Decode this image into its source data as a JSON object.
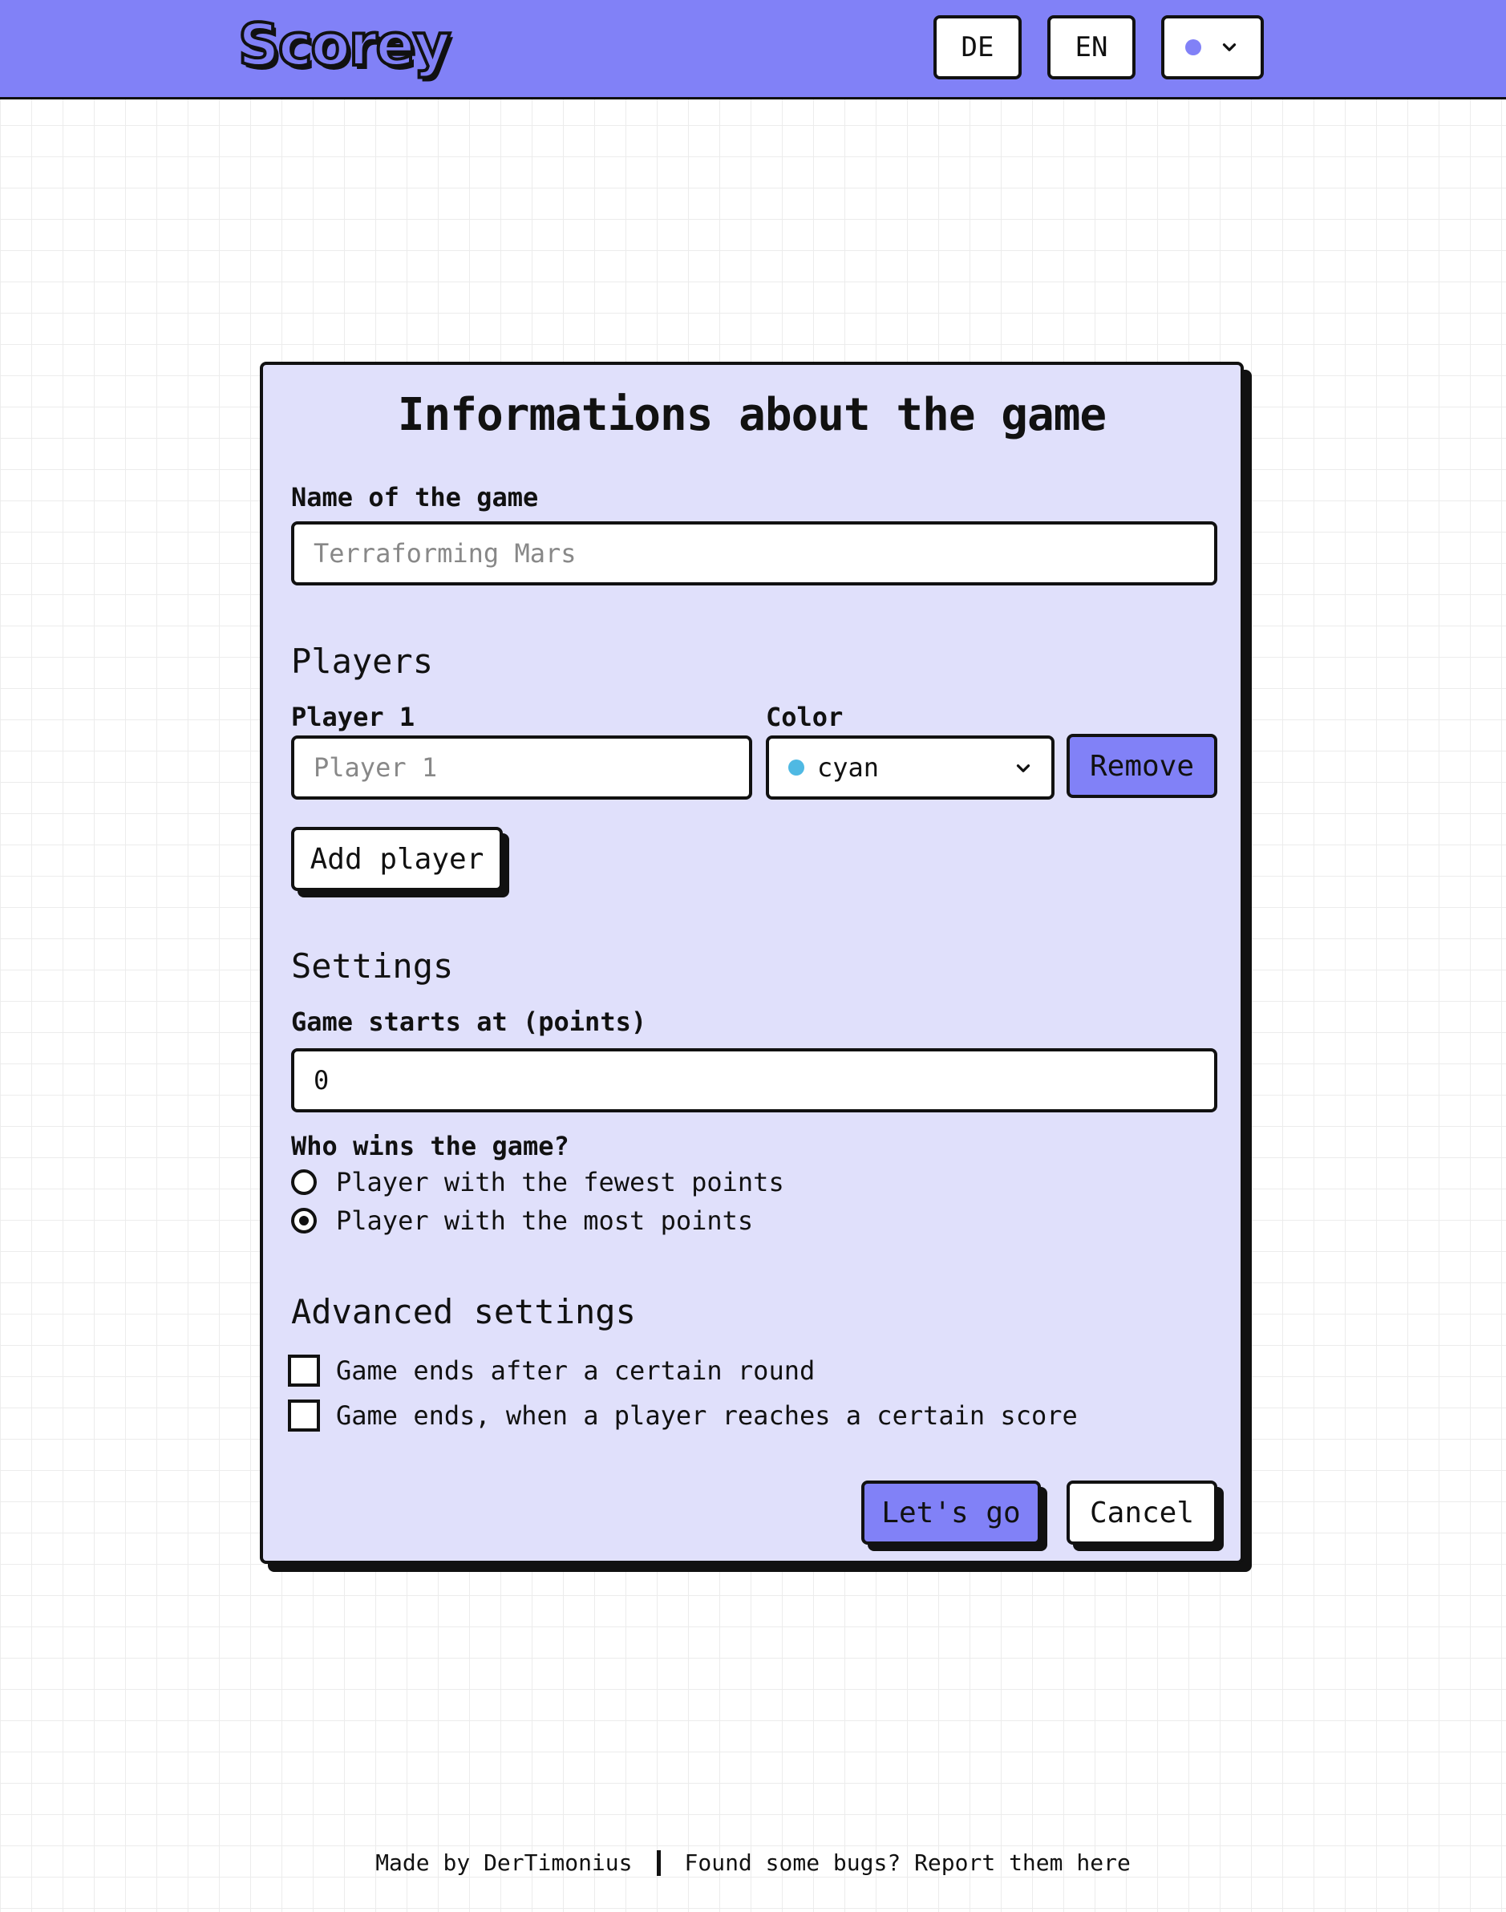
{
  "header": {
    "logo": "Scorey",
    "lang_de": "DE",
    "lang_en": "EN",
    "theme_color": "#8181f7"
  },
  "card": {
    "title": "Informations about the game",
    "game_name": {
      "label": "Name of the game",
      "placeholder": "Terraforming Mars",
      "value": ""
    },
    "players_section": "Players",
    "players": [
      {
        "label": "Player 1",
        "placeholder": "Player 1",
        "color_label": "Color",
        "color_value": "cyan",
        "color_hex": "#4fb9e3",
        "remove_label": "Remove"
      }
    ],
    "add_player_label": "Add player",
    "settings_section": "Settings",
    "start_points": {
      "label": "Game starts at (points)",
      "value": "0"
    },
    "winner": {
      "label": "Who wins the game?",
      "options": [
        {
          "label": "Player with the fewest points",
          "checked": false
        },
        {
          "label": "Player with the most points",
          "checked": true
        }
      ]
    },
    "advanced_section": "Advanced settings",
    "advanced_options": [
      {
        "label": "Game ends after a certain round",
        "checked": false
      },
      {
        "label": "Game ends, when a player reaches a certain score",
        "checked": false
      }
    ],
    "submit_label": "Let's go",
    "cancel_label": "Cancel"
  },
  "footer": {
    "made_by": "Made by DerTimonius",
    "bugs": "Found some bugs? Report them here"
  },
  "colors": {
    "accent": "#8181f7",
    "card_bg": "#e0e0fb"
  }
}
